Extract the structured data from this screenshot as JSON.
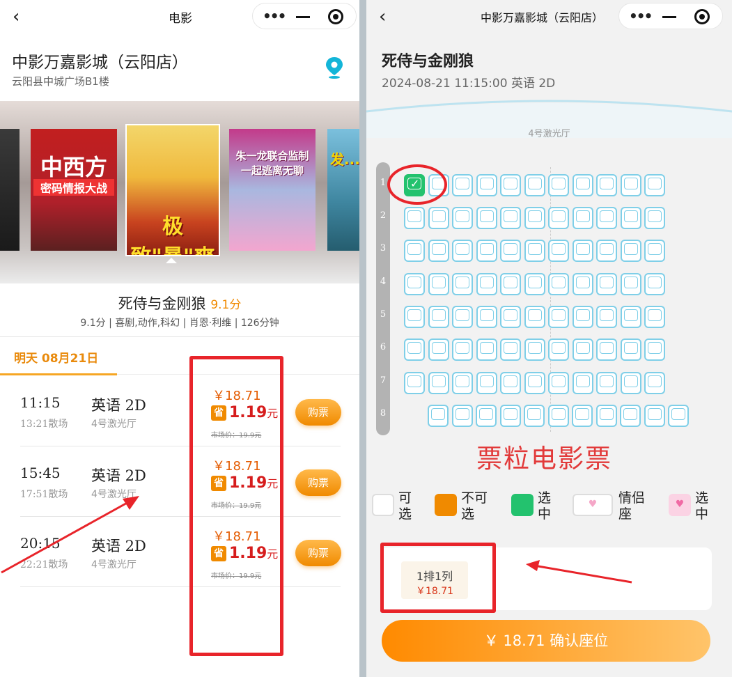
{
  "left": {
    "nav_title": "电影",
    "cinema_name": "中影万嘉影城（云阳店）",
    "cinema_address": "云阳县中城广场B1楼",
    "posters": [
      {
        "title": "中西方",
        "subtitle": "密码情报大战"
      },
      {
        "title": "极致\"暴\"爽"
      },
      {
        "title": "朱一龙联合监制 一起逃离无聊"
      },
      {
        "title": "发..."
      }
    ],
    "movie_title": "死侍与金刚狼",
    "movie_score": "9.1分",
    "movie_meta": "9.1分 | 喜剧,动作,科幻 | 肖恩·利维 | 126分钟",
    "date_tab": "明天 08月21日",
    "showtimes": [
      {
        "time": "11:15",
        "end": "13:21散场",
        "lang": "英语 2D",
        "hall": "4号激光厅",
        "price": "￥18.71",
        "save_badge": "省",
        "save": "1.19",
        "save_unit": "元",
        "market": "市场价：19.9元",
        "buy": "购票"
      },
      {
        "time": "15:45",
        "end": "17:51散场",
        "lang": "英语 2D",
        "hall": "4号激光厅",
        "price": "￥18.71",
        "save_badge": "省",
        "save": "1.19",
        "save_unit": "元",
        "market": "市场价：19.9元",
        "buy": "购票"
      },
      {
        "time": "20:15",
        "end": "22:21散场",
        "lang": "英语 2D",
        "hall": "4号激光厅",
        "price": "￥18.71",
        "save_badge": "省",
        "save": "1.19",
        "save_unit": "元",
        "market": "市场价：19.9元",
        "buy": "购票"
      }
    ]
  },
  "right": {
    "nav_title": "中影万嘉影城（云阳店）",
    "movie_title": "死侍与金刚狼",
    "session": "2024-08-21 11:15:00 英语 2D",
    "hall_name": "4号激光厅",
    "row_labels": [
      "1",
      "2",
      "3",
      "4",
      "5",
      "6",
      "7",
      "8"
    ],
    "watermark": "票粒电影票",
    "legend": [
      {
        "label": "可选",
        "color": "#ffffff"
      },
      {
        "label": "不可选",
        "color": "#f08a00"
      },
      {
        "label": "选中",
        "color": "#23c26e"
      },
      {
        "label": "情侣座",
        "color": "#ffffff"
      },
      {
        "label": "选中",
        "color": "#f5a7c8"
      }
    ],
    "selected_seat": "1排1列",
    "selected_price": "￥18.71",
    "confirm": "￥ 18.71 确认座位"
  },
  "colors": {
    "accent": "#f08a00",
    "selected": "#23c26e",
    "seat_outline": "#7fcfe8",
    "annotation": "#e8242a"
  }
}
